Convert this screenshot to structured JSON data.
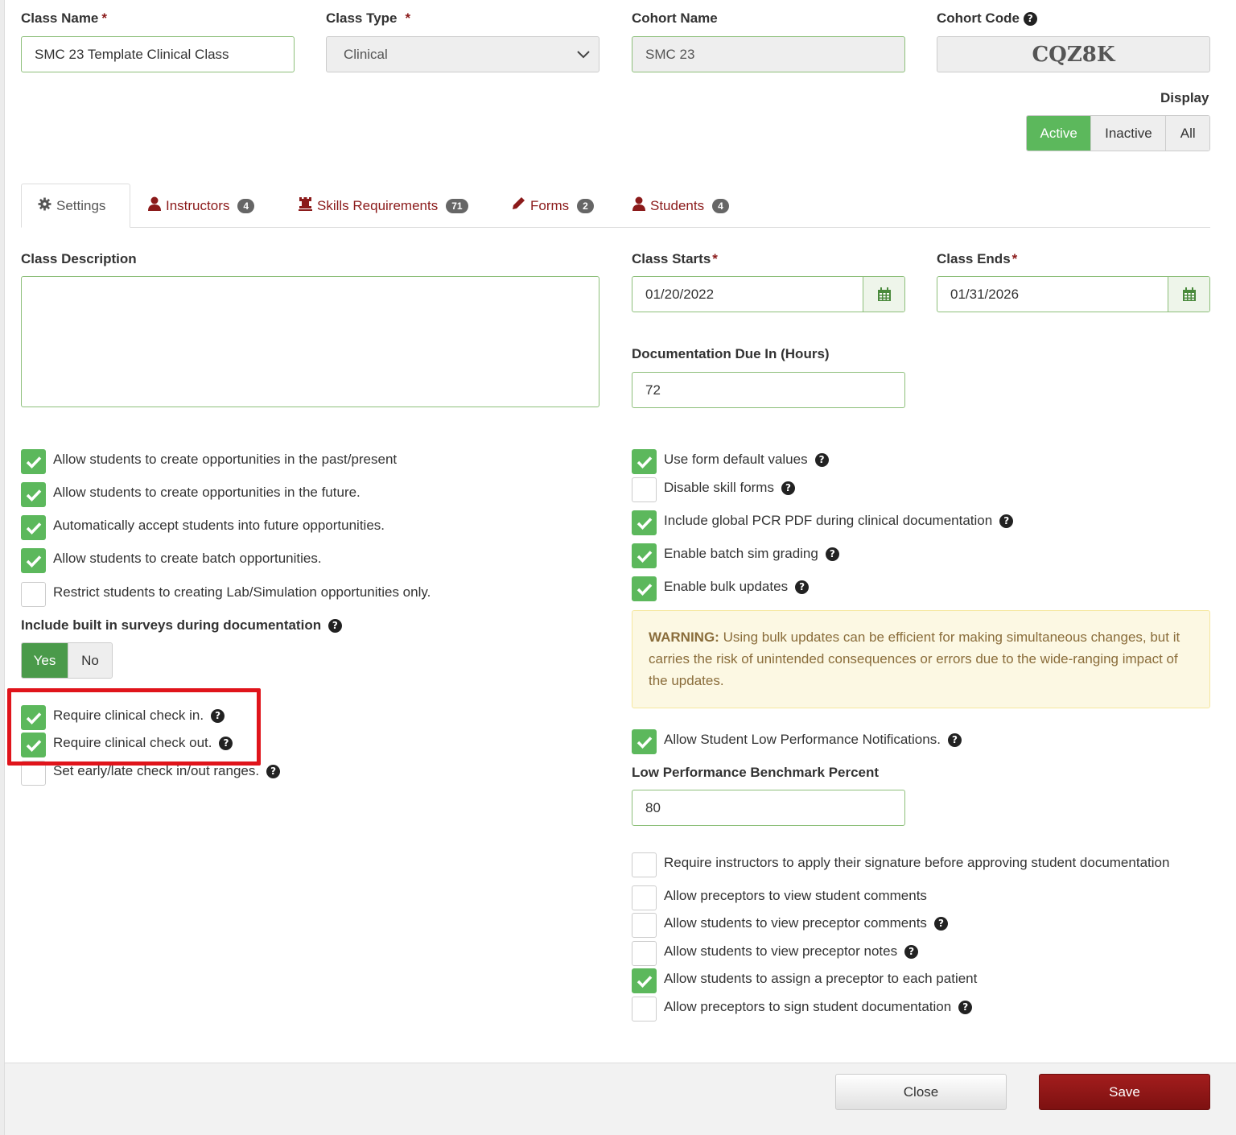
{
  "header": {
    "class_name": {
      "label": "Class Name",
      "required": "*",
      "value": "SMC 23 Template Clinical Class"
    },
    "class_type": {
      "label": "Class Type",
      "required": "*",
      "value": "Clinical"
    },
    "cohort_name": {
      "label": "Cohort Name",
      "value": "SMC 23"
    },
    "cohort_code": {
      "label": "Cohort Code",
      "value": "CQZ8K"
    }
  },
  "display": {
    "label": "Display",
    "options": [
      "Active",
      "Inactive",
      "All"
    ],
    "selected": "Active"
  },
  "tabs": [
    {
      "label": "Settings",
      "icon": "gear-icon",
      "active": true
    },
    {
      "label": "Instructors",
      "icon": "user-icon",
      "count": "4"
    },
    {
      "label": "Skills Requirements",
      "icon": "rook-icon",
      "count": "71"
    },
    {
      "label": "Forms",
      "icon": "pencil-icon",
      "count": "2"
    },
    {
      "label": "Students",
      "icon": "user-icon",
      "count": "4"
    }
  ],
  "settings": {
    "class_description": {
      "label": "Class Description",
      "value": ""
    },
    "class_starts": {
      "label": "Class Starts",
      "required": "*",
      "value": "01/20/2022"
    },
    "class_ends": {
      "label": "Class Ends",
      "required": "*",
      "value": "01/31/2026"
    },
    "documentation_due": {
      "label": "Documentation Due In (Hours)",
      "value": "72"
    },
    "left_checks": [
      {
        "label": "Allow students to create opportunities in the past/present",
        "checked": true
      },
      {
        "label": "Allow students to create opportunities in the future.",
        "checked": true
      },
      {
        "label": "Automatically accept students into future opportunities.",
        "checked": true
      },
      {
        "label": "Allow students to create batch opportunities.",
        "checked": true
      },
      {
        "label": "Restrict students to creating Lab/Simulation opportunities only.",
        "checked": false
      }
    ],
    "surveys": {
      "label": "Include built in surveys during documentation",
      "yes": "Yes",
      "no": "No",
      "selected": "Yes"
    },
    "checkin_checks": [
      {
        "label": "Require clinical check in.",
        "checked": true
      },
      {
        "label": "Require clinical check out.",
        "checked": true
      },
      {
        "label": "Set early/late check in/out ranges.",
        "checked": false
      }
    ],
    "right_checks": [
      {
        "label": "Use form default values",
        "checked": true
      },
      {
        "label": "Disable skill forms",
        "checked": false
      },
      {
        "label": "Include global PCR PDF during clinical documentation",
        "checked": true
      },
      {
        "label": "Enable batch sim grading",
        "checked": true
      },
      {
        "label": "Enable bulk updates",
        "checked": true
      }
    ],
    "warning": {
      "title": "WARNING:",
      "text": "Using bulk updates can be efficient for making simultaneous changes, but it carries the risk of unintended consequences or errors due to the wide-ranging impact of the updates."
    },
    "low_perf_notifications": {
      "label": "Allow Student Low Performance Notifications.",
      "checked": true
    },
    "benchmark": {
      "label": "Low Performance Benchmark Percent",
      "value": "80"
    },
    "preceptor_checks": [
      {
        "label": "Require instructors to apply their signature before approving student documentation",
        "checked": false
      },
      {
        "label": "Allow preceptors to view student comments",
        "checked": false
      },
      {
        "label": "Allow students to view preceptor comments",
        "checked": false
      },
      {
        "label": "Allow students to view preceptor notes",
        "checked": false
      },
      {
        "label": "Allow students to assign a preceptor to each patient",
        "checked": true
      },
      {
        "label": "Allow preceptors to sign student documentation",
        "checked": false
      }
    ]
  },
  "footer": {
    "close_label": "Close",
    "save_label": "Save"
  },
  "colors": {
    "accent": "#8b1a1a",
    "success": "#5cb85c",
    "highlight": "#e0141b"
  }
}
